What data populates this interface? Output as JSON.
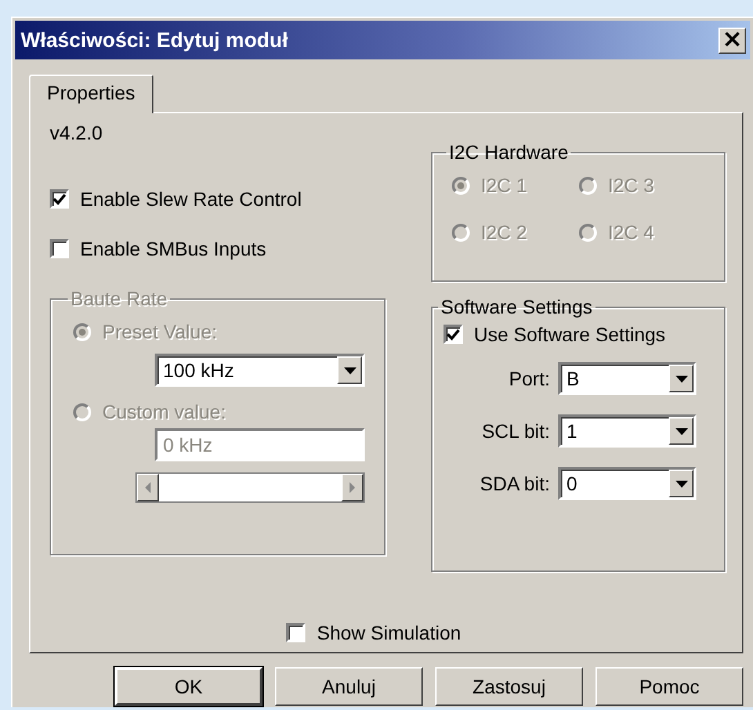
{
  "window": {
    "title": "Właściwości: Edytuj moduł",
    "close": "×"
  },
  "tabs": [
    {
      "label": "Properties",
      "selected": true
    }
  ],
  "version": "v4.2.0",
  "options": [
    {
      "label": "Enable Slew Rate Control",
      "checked": true
    },
    {
      "label": "Enable SMBus Inputs",
      "checked": false
    }
  ],
  "baud_rate": {
    "title": "Baute Rate",
    "disabled": true,
    "preset": {
      "label": "Preset Value:",
      "selected": true,
      "value": "100 kHz"
    },
    "custom": {
      "label": "Custom value:",
      "selected": false,
      "value": "0 kHz"
    }
  },
  "i2c_hardware": {
    "title": "I2C Hardware",
    "disabled": true,
    "options": [
      {
        "label": "I2C 1",
        "selected": true
      },
      {
        "label": "I2C 3",
        "selected": false
      },
      {
        "label": "I2C 2",
        "selected": false
      },
      {
        "label": "I2C 4",
        "selected": false
      }
    ]
  },
  "software_settings": {
    "title": "Software Settings",
    "use": {
      "label": "Use Software Settings",
      "checked": true
    },
    "fields": [
      {
        "label": "Port:",
        "value": "B"
      },
      {
        "label": "SCL bit:",
        "value": "1"
      },
      {
        "label": "SDA bit:",
        "value": "0"
      }
    ]
  },
  "show_simulation": {
    "label": "Show Simulation",
    "checked": false
  },
  "buttons": [
    {
      "label": "OK",
      "default": true
    },
    {
      "label": "Anuluj",
      "default": false
    },
    {
      "label": "Zastosuj",
      "default": false
    },
    {
      "label": "Pomoc",
      "default": false
    }
  ]
}
